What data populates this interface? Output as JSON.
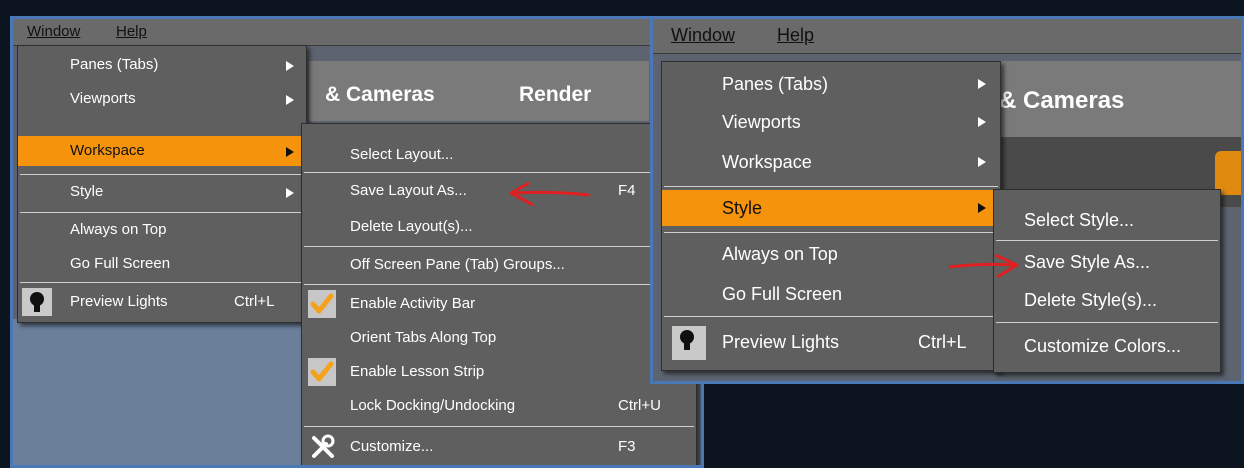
{
  "left_panel": {
    "menubar": {
      "window": "Window",
      "help": "Help"
    },
    "bg_tabs": {
      "cameras": "& Cameras",
      "render": "Render"
    },
    "window_menu": [
      {
        "label": "Panes (Tabs)"
      },
      {
        "label": "Viewports"
      },
      {
        "label": "Workspace"
      },
      {
        "label": "Style"
      },
      {
        "label": "Always on Top"
      },
      {
        "label": "Go Full Screen"
      },
      {
        "label": "Preview Lights",
        "shortcut": "Ctrl+L"
      }
    ],
    "workspace_submenu": [
      {
        "label": "Select Layout..."
      },
      {
        "label": "Save Layout As...",
        "shortcut": "F4"
      },
      {
        "label": "Delete Layout(s)..."
      },
      {
        "label": "Off Screen Pane (Tab) Groups..."
      },
      {
        "label": "Enable Activity Bar"
      },
      {
        "label": "Orient Tabs Along Top"
      },
      {
        "label": "Enable Lesson Strip"
      },
      {
        "label": "Lock Docking/Undocking",
        "shortcut": "Ctrl+U"
      },
      {
        "label": "Customize...",
        "shortcut": "F3"
      }
    ]
  },
  "right_panel": {
    "menubar": {
      "window": "Window",
      "help": "Help"
    },
    "bg_tabs": {
      "cameras": "& Cameras"
    },
    "window_menu": [
      {
        "label": "Panes (Tabs)"
      },
      {
        "label": "Viewports"
      },
      {
        "label": "Workspace"
      },
      {
        "label": "Style"
      },
      {
        "label": "Always on Top"
      },
      {
        "label": "Go Full Screen"
      },
      {
        "label": "Preview Lights",
        "shortcut": "Ctrl+L"
      }
    ],
    "style_submenu": [
      {
        "label": "Select Style..."
      },
      {
        "label": "Save Style As..."
      },
      {
        "label": "Delete Style(s)..."
      },
      {
        "label": "Customize Colors..."
      }
    ]
  },
  "colors": {
    "highlight": "#f5930c",
    "menu_bg": "#5f5f5f",
    "frame": "#4a78b6",
    "annotation": "#e02020"
  }
}
